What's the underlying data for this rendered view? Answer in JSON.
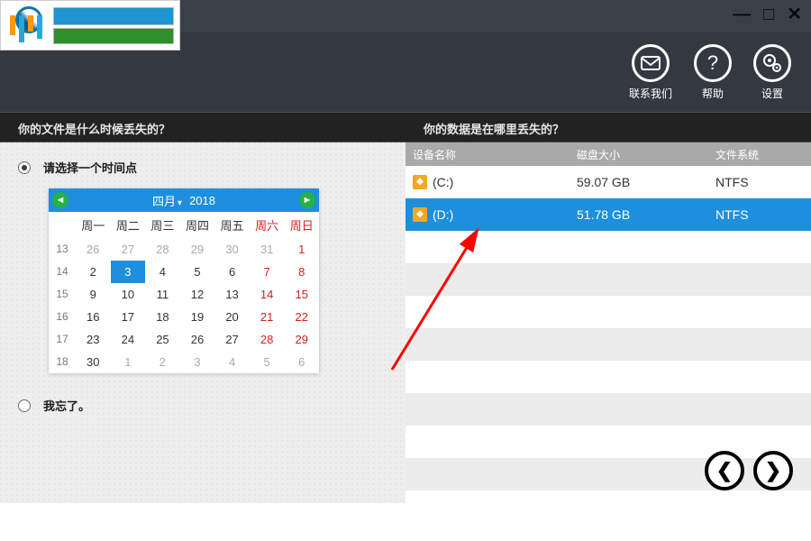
{
  "window": {
    "minimize": "—",
    "maximize": "□",
    "close": "✕"
  },
  "toolbar": {
    "contact_label": "联系我们",
    "help_label": "帮助",
    "settings_label": "设置"
  },
  "questions": {
    "left": "你的文件是什么时候丢失的？",
    "right": "你的数据是在哪里丢失的？"
  },
  "time_panel": {
    "option_select_label": "请选择一个时间点",
    "option_forgot_label": "我忘了。"
  },
  "calendar": {
    "month_label": "四月",
    "year_label": "2018",
    "day_headers": [
      "周一",
      "周二",
      "周三",
      "周四",
      "周五",
      "周六",
      "周日"
    ],
    "week_numbers": [
      "13",
      "14",
      "15",
      "16",
      "17",
      "18"
    ],
    "cells": [
      [
        {
          "n": "26",
          "t": "prev"
        },
        {
          "n": "27",
          "t": "prev"
        },
        {
          "n": "28",
          "t": "prev"
        },
        {
          "n": "29",
          "t": "prev"
        },
        {
          "n": "30",
          "t": "prev"
        },
        {
          "n": "31",
          "t": "prev"
        },
        {
          "n": "1",
          "t": "wkend"
        }
      ],
      [
        {
          "n": "2",
          "t": ""
        },
        {
          "n": "3",
          "t": "sel"
        },
        {
          "n": "4",
          "t": ""
        },
        {
          "n": "5",
          "t": ""
        },
        {
          "n": "6",
          "t": ""
        },
        {
          "n": "7",
          "t": "wkend"
        },
        {
          "n": "8",
          "t": "wkend"
        }
      ],
      [
        {
          "n": "9",
          "t": ""
        },
        {
          "n": "10",
          "t": ""
        },
        {
          "n": "11",
          "t": ""
        },
        {
          "n": "12",
          "t": ""
        },
        {
          "n": "13",
          "t": ""
        },
        {
          "n": "14",
          "t": "wkend"
        },
        {
          "n": "15",
          "t": "wkend"
        }
      ],
      [
        {
          "n": "16",
          "t": ""
        },
        {
          "n": "17",
          "t": ""
        },
        {
          "n": "18",
          "t": ""
        },
        {
          "n": "19",
          "t": ""
        },
        {
          "n": "20",
          "t": ""
        },
        {
          "n": "21",
          "t": "wkend"
        },
        {
          "n": "22",
          "t": "wkend"
        }
      ],
      [
        {
          "n": "23",
          "t": ""
        },
        {
          "n": "24",
          "t": ""
        },
        {
          "n": "25",
          "t": ""
        },
        {
          "n": "26",
          "t": ""
        },
        {
          "n": "27",
          "t": ""
        },
        {
          "n": "28",
          "t": "wkend"
        },
        {
          "n": "29",
          "t": "wkend"
        }
      ],
      [
        {
          "n": "30",
          "t": ""
        },
        {
          "n": "1",
          "t": "next"
        },
        {
          "n": "2",
          "t": "next"
        },
        {
          "n": "3",
          "t": "next"
        },
        {
          "n": "4",
          "t": "next"
        },
        {
          "n": "5",
          "t": "next"
        },
        {
          "n": "6",
          "t": "next"
        }
      ]
    ]
  },
  "drive_panel": {
    "headers": {
      "name": "设备名称",
      "size": "磁盘大小",
      "fs": "文件系统"
    },
    "rows": [
      {
        "name": "(C:)",
        "size": "59.07 GB",
        "fs": "NTFS",
        "selected": false
      },
      {
        "name": "(D:)",
        "size": "51.78 GB",
        "fs": "NTFS",
        "selected": true
      }
    ]
  },
  "footer": {
    "prev": "❮",
    "next": "❯"
  }
}
